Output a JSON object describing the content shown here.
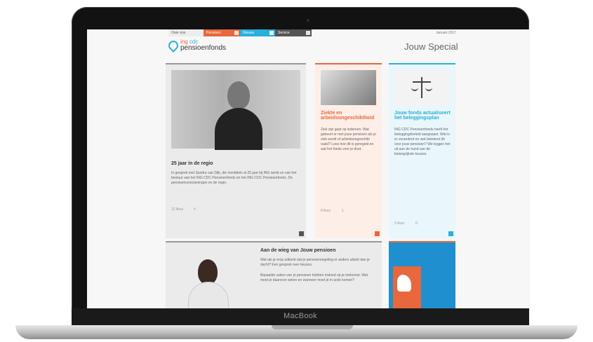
{
  "device": {
    "label": "MacBook"
  },
  "site": {
    "topbar": [
      {
        "label": "Over ons"
      },
      {
        "label": "Pensioen"
      },
      {
        "label": "Nieuws"
      },
      {
        "label": "Service"
      }
    ],
    "date": "Januari 2017",
    "logo": {
      "line1_a": "ing",
      "line1_b": "cdc",
      "line2": "pensioenfonds"
    },
    "special": "Jouw Special"
  },
  "cards": {
    "main": {
      "title": "25 jaar in de regio",
      "text": "In gesprek met Sandra van Dijk, die inmiddels al 25 jaar bij ING werkt en van het bestuur van het ING CDC Pensioenfonds en het ING CDC Pensioenfonds. De pensioenvoorzieningen en de regio.",
      "meta_a": "12 likes",
      "meta_b": "4"
    },
    "mid": {
      "title": "Ziekte en arbeidsongeschiktheid",
      "text": "Ziek zijn gaat op iedereen. Wat gebeurt er met jouw pensioen als je ziek wordt of arbeidsongeschikt raakt? Lees hoe dit is geregeld en wat het fonds voor je doet.",
      "meta_a": "8 likes",
      "meta_b": "1"
    },
    "right": {
      "title": "Jouw fonds actualiseert het beleggingsplan",
      "text": "ING CDC Pensioenfonds heeft het beleggingsbeleid aangepast. Wat is er veranderd en wat betekent dit voor jouw pensioen? We leggen het uit aan de hand van de belangrijkste keuzes.",
      "meta_a": "5 likes",
      "meta_b": "0"
    },
    "bottom": {
      "title": "Aan de wieg van Jouw pensioen",
      "text1": "Wat als je erop uitkomt dat je pensioenregeling er anders uitziet dan je dacht? Een gesprek over keuzes.",
      "text2": "Bepaalde zaken van je pensioen hebben invloed op je toekomst. Wat moet je daarvoor weten en wanneer moet je in actie komen?"
    }
  },
  "colors": {
    "orange": "#e8673c",
    "blue": "#27b0d9",
    "grey": "#555555"
  }
}
